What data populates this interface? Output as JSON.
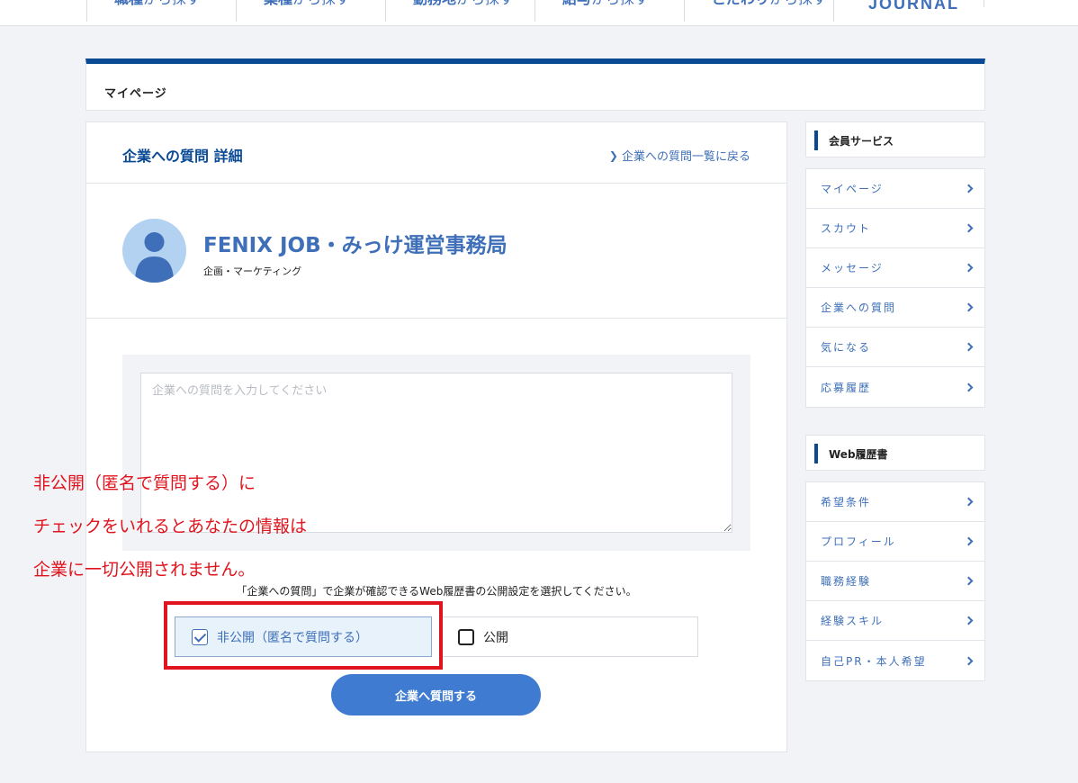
{
  "topnav": {
    "items": [
      {
        "main": "職種",
        "sub": "から探す"
      },
      {
        "main": "業種",
        "sub": "から探す"
      },
      {
        "main": "勤務地",
        "sub": "から探す"
      },
      {
        "main": "給与",
        "sub": "から探す"
      },
      {
        "main": "こだわり",
        "sub": "から探す"
      }
    ],
    "journal": "JOURNAL"
  },
  "mypage": {
    "label": "マイページ"
  },
  "card": {
    "title": "企業への質問 詳細",
    "back_link": "企業への質問一覧に戻る",
    "company_name": "FENIX JOB・みっけ運営事務局",
    "company_category": "企画・マーケティング",
    "textarea_placeholder": "企業への質問を入力してください",
    "privacy_note": "「企業への質問」で企業が確認できるWeb履歴書の公開設定を選択してください。",
    "option_private": "非公開（匿名で質問する）",
    "option_public": "公開",
    "submit": "企業へ質問する"
  },
  "annotation": {
    "line1": "非公開（匿名で質問する）に",
    "line2": "チェックをいれるとあなたの情報は",
    "line3": "企業に一切公開されません。"
  },
  "sidebar": {
    "member_title": "会員サービス",
    "member_items": [
      "マイページ",
      "スカウト",
      "メッセージ",
      "企業への質問",
      "気になる",
      "応募履歴"
    ],
    "resume_title": "Web履歴書",
    "resume_items": [
      "希望条件",
      "プロフィール",
      "職務経験",
      "経験スキル",
      "自己PR・本人希望"
    ]
  },
  "colors": {
    "brand_dark": "#0a4a94",
    "brand": "#3e6fb8",
    "button": "#3f7bd1",
    "annotation": "#e0141e"
  }
}
